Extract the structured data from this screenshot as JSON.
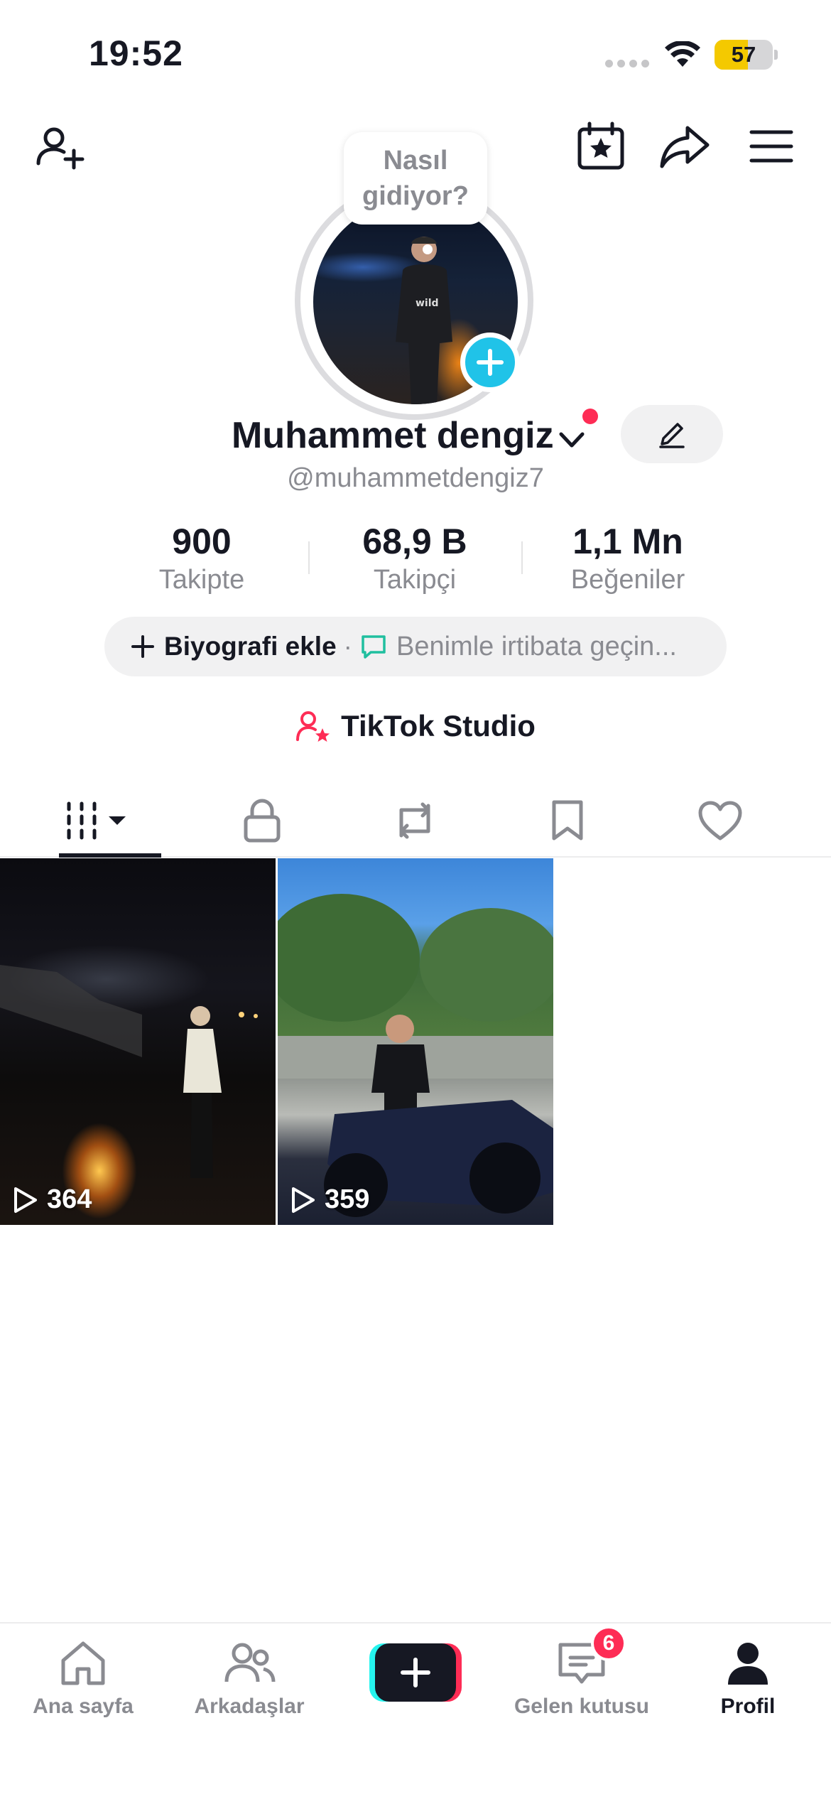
{
  "status_bar": {
    "time": "19:52",
    "battery_level": "57",
    "battery_fraction": 0.57
  },
  "top_bar": {
    "icons": [
      "add-friend-icon",
      "calendar-star-icon",
      "share-icon",
      "menu-icon"
    ]
  },
  "profile": {
    "bubble_text": "Nasıl gidiyor?",
    "display_name": "Muhammet dengiz",
    "username": "@muhammetdengiz7",
    "stats": [
      {
        "value": "900",
        "label": "Takipte"
      },
      {
        "value": "68,9 B",
        "label": "Takipçi"
      },
      {
        "value": "1,1 Mn",
        "label": "Beğeniler"
      }
    ],
    "bio_add_label": "Biyografi ekle",
    "bio_separator": "·",
    "contact_label": "Benimle irtibata geçin...",
    "studio_label": "TikTok Studio"
  },
  "tabs": [
    "videos-grid-icon",
    "lock-icon",
    "repost-icon",
    "bookmark-icon",
    "heart-icon"
  ],
  "videos": [
    {
      "views": "364"
    },
    {
      "views": "359"
    }
  ],
  "bottom_nav": {
    "home": "Ana sayfa",
    "friends": "Arkadaşlar",
    "inbox": "Gelen kutusu",
    "inbox_badge": "6",
    "profile": "Profil"
  },
  "colors": {
    "accent_red": "#fe2c55",
    "accent_cyan": "#25f4ee",
    "plus_blue": "#20c3e8",
    "battery_yellow": "#f4c900"
  }
}
